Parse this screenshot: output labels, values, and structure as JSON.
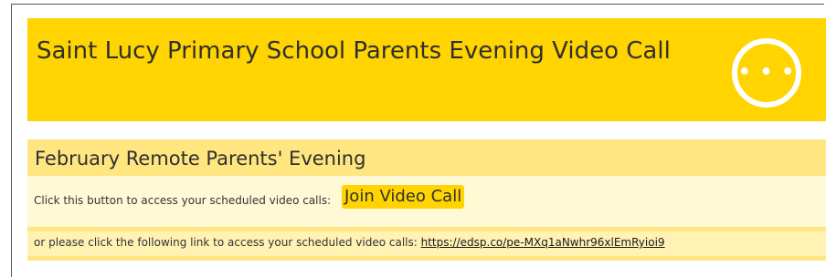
{
  "header": {
    "title": "Saint Lucy Primary School Parents Evening Video Call",
    "more_icon_glyph": "• • •",
    "more_icon": "more-options-icon",
    "color": "#ffd400"
  },
  "event": {
    "title": "February Remote Parents' Evening",
    "button_prompt": "Click this button to access your scheduled video calls:",
    "join_label": "Join Video Call",
    "link_prompt": "or please click the following link to access your scheduled video calls:",
    "link_url": "https://edsp.co/pe-MXq1aNwhr96xlEmRyioi9",
    "colors": {
      "panel": "#ffe680",
      "row_light": "#fff9d6",
      "row_alt": "#fff2b3",
      "button": "#ffd400"
    }
  }
}
